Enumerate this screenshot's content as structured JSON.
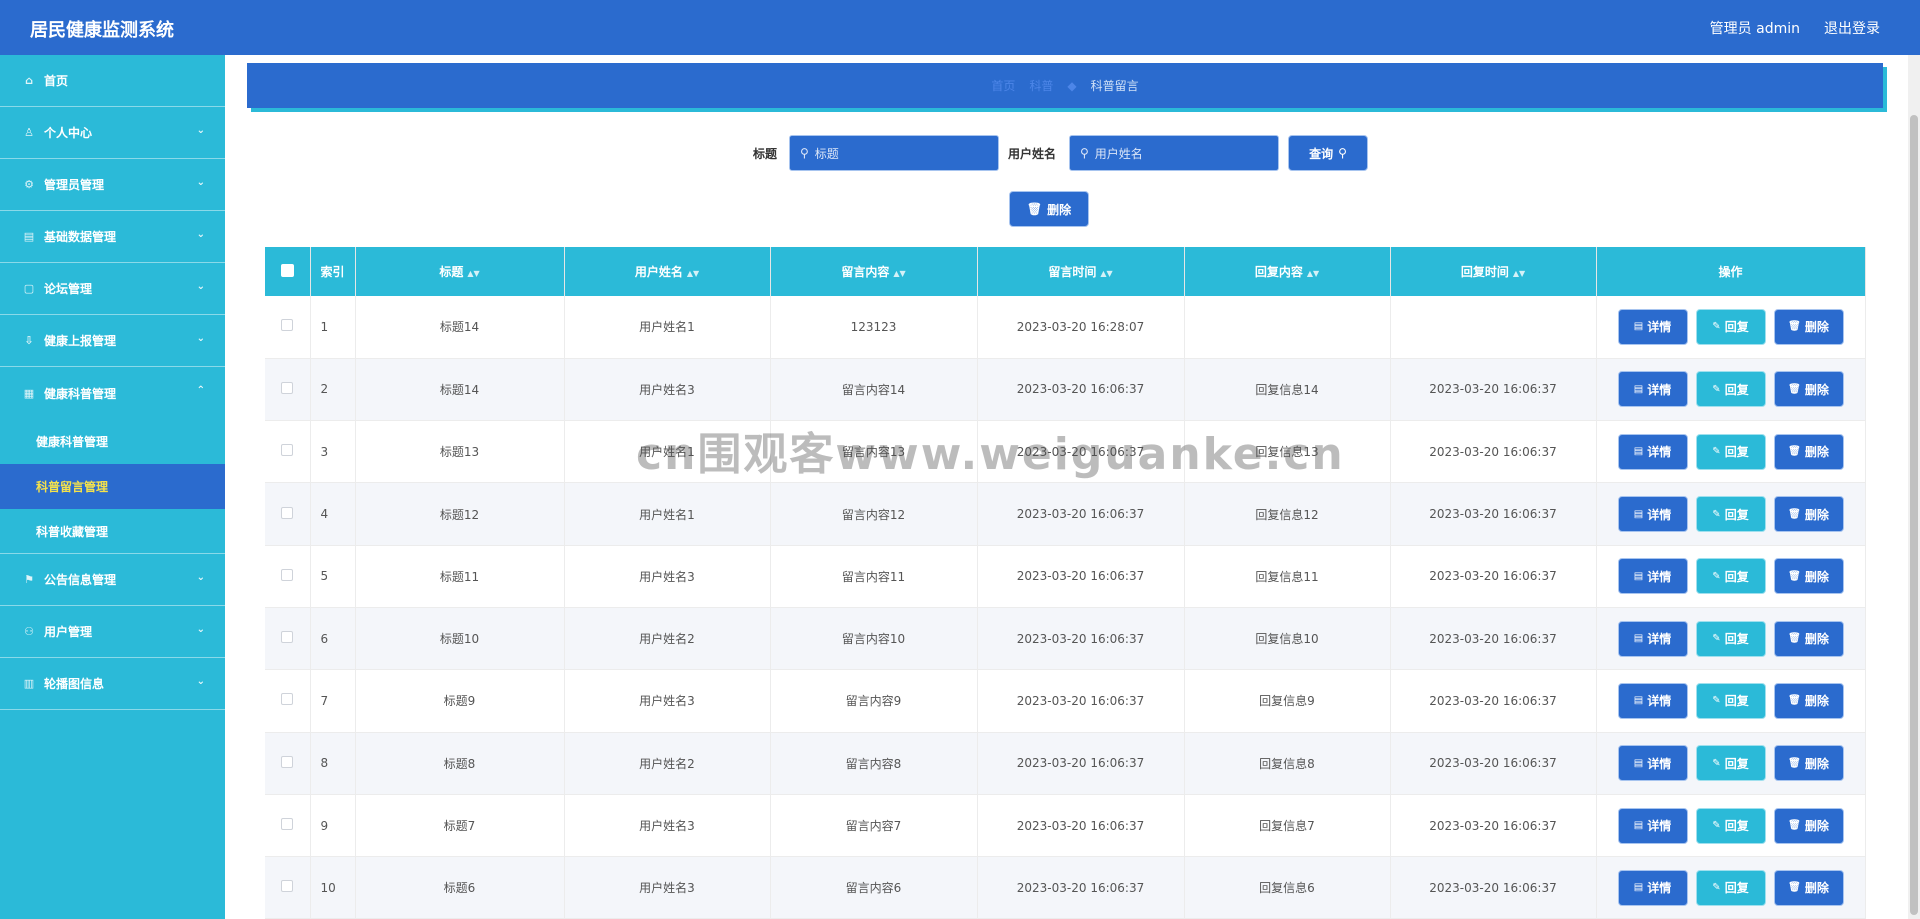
{
  "app": {
    "title": "居民健康监测系统",
    "admin_label": "管理员 admin",
    "logout_label": "退出登录"
  },
  "sidebar": {
    "items": [
      {
        "label": "首页",
        "icon": "home-icon"
      },
      {
        "label": "个人中心",
        "icon": "user-icon"
      },
      {
        "label": "管理员管理",
        "icon": "settings-icon"
      },
      {
        "label": "基础数据管理",
        "icon": "database-icon"
      },
      {
        "label": "论坛管理",
        "icon": "forum-icon"
      },
      {
        "label": "健康上报管理",
        "icon": "upload-icon"
      },
      {
        "label": "健康科普管理",
        "icon": "book-icon"
      },
      {
        "label": "公告信息管理",
        "icon": "flag-icon"
      },
      {
        "label": "用户管理",
        "icon": "users-icon"
      },
      {
        "label": "轮播图信息",
        "icon": "chart-icon"
      }
    ],
    "submenu": [
      {
        "label": "健康科普管理"
      },
      {
        "label": "科普留言管理",
        "active": true
      },
      {
        "label": "科普收藏管理"
      }
    ]
  },
  "breadcrumb": {
    "home": "首页",
    "middle": "科普",
    "current": "科普留言"
  },
  "search": {
    "title_label": "标题",
    "title_placeholder": "标题",
    "username_label": "用户姓名",
    "username_placeholder": "用户姓名",
    "query_label": "查询",
    "delete_label": "删除"
  },
  "table": {
    "headers": [
      "索引",
      "标题",
      "用户姓名",
      "留言内容",
      "留言时间",
      "回复内容",
      "回复时间",
      "操作"
    ],
    "rows": [
      {
        "index": "1",
        "title": "标题14",
        "user": "用户姓名1",
        "content": "123123",
        "time": "2023-03-20 16:28:07",
        "reply": "",
        "reply_time": ""
      },
      {
        "index": "2",
        "title": "标题14",
        "user": "用户姓名3",
        "content": "留言内容14",
        "time": "2023-03-20 16:06:37",
        "reply": "回复信息14",
        "reply_time": "2023-03-20 16:06:37"
      },
      {
        "index": "3",
        "title": "标题13",
        "user": "用户姓名1",
        "content": "留言内容13",
        "time": "2023-03-20 16:06:37",
        "reply": "回复信息13",
        "reply_time": "2023-03-20 16:06:37"
      },
      {
        "index": "4",
        "title": "标题12",
        "user": "用户姓名1",
        "content": "留言内容12",
        "time": "2023-03-20 16:06:37",
        "reply": "回复信息12",
        "reply_time": "2023-03-20 16:06:37"
      },
      {
        "index": "5",
        "title": "标题11",
        "user": "用户姓名3",
        "content": "留言内容11",
        "time": "2023-03-20 16:06:37",
        "reply": "回复信息11",
        "reply_time": "2023-03-20 16:06:37"
      },
      {
        "index": "6",
        "title": "标题10",
        "user": "用户姓名2",
        "content": "留言内容10",
        "time": "2023-03-20 16:06:37",
        "reply": "回复信息10",
        "reply_time": "2023-03-20 16:06:37"
      },
      {
        "index": "7",
        "title": "标题9",
        "user": "用户姓名3",
        "content": "留言内容9",
        "time": "2023-03-20 16:06:37",
        "reply": "回复信息9",
        "reply_time": "2023-03-20 16:06:37"
      },
      {
        "index": "8",
        "title": "标题8",
        "user": "用户姓名2",
        "content": "留言内容8",
        "time": "2023-03-20 16:06:37",
        "reply": "回复信息8",
        "reply_time": "2023-03-20 16:06:37"
      },
      {
        "index": "9",
        "title": "标题7",
        "user": "用户姓名3",
        "content": "留言内容7",
        "time": "2023-03-20 16:06:37",
        "reply": "回复信息7",
        "reply_time": "2023-03-20 16:06:37"
      },
      {
        "index": "10",
        "title": "标题6",
        "user": "用户姓名3",
        "content": "留言内容6",
        "time": "2023-03-20 16:06:37",
        "reply": "回复信息6",
        "reply_time": "2023-03-20 16:06:37"
      }
    ],
    "actions": {
      "detail": "详情",
      "reply": "回复",
      "delete": "删除"
    }
  },
  "watermark": "cn围观客www.weiguanke.cn",
  "colors": {
    "primary": "#2b6bce",
    "accent": "#2bbad8",
    "active_text": "#f5e24b"
  }
}
